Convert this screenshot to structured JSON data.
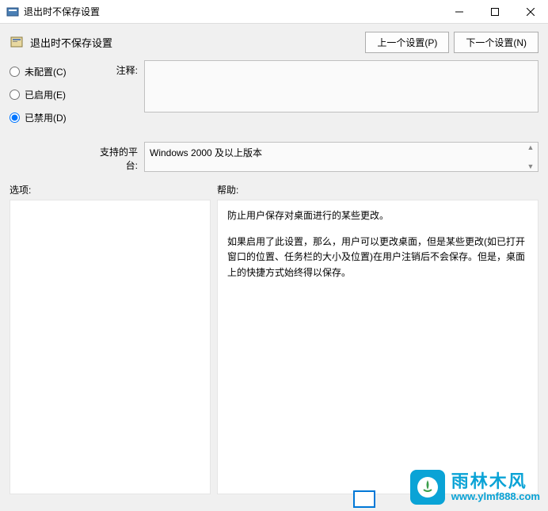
{
  "window": {
    "title": "退出时不保存设置"
  },
  "header": {
    "title": "退出时不保存设置",
    "prev_btn": "上一个设置(P)",
    "next_btn": "下一个设置(N)"
  },
  "radios": {
    "not_configured": "未配置(C)",
    "enabled": "已启用(E)",
    "disabled": "已禁用(D)",
    "selected": "disabled"
  },
  "labels": {
    "comment": "注释:",
    "platform": "支持的平台:",
    "options": "选项:",
    "help": "帮助:"
  },
  "platform_value": "Windows 2000 及以上版本",
  "help": {
    "p1": "防止用户保存对桌面进行的某些更改。",
    "p2": "如果启用了此设置，那么，用户可以更改桌面，但是某些更改(如已打开窗口的位置、任务栏的大小及位置)在用户注销后不会保存。但是，桌面上的快捷方式始终得以保存。"
  },
  "watermark": {
    "cn": "雨林木风",
    "url": "www.ylmf888.com"
  }
}
